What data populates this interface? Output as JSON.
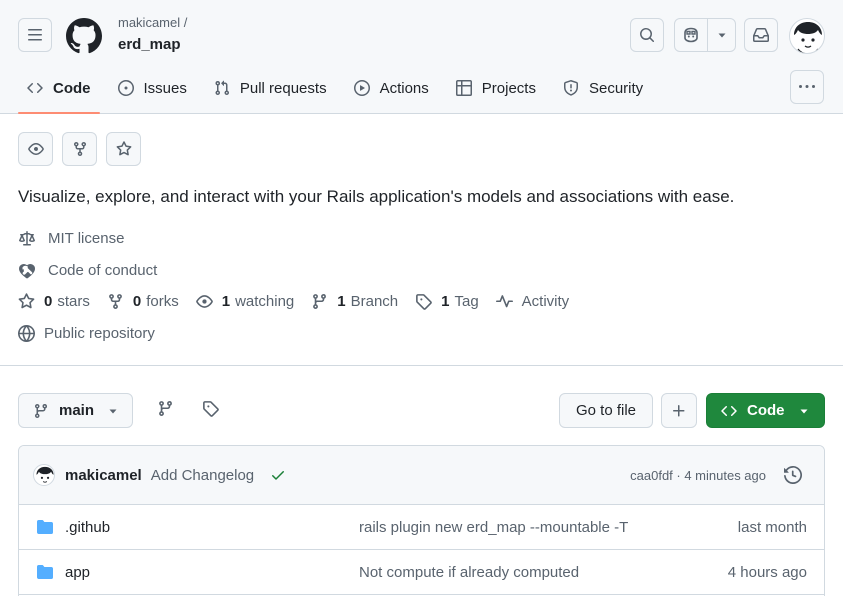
{
  "header": {
    "owner": "makicamel /",
    "repo": "erd_map"
  },
  "tabs": [
    {
      "label": "Code",
      "icon": "code-icon"
    },
    {
      "label": "Issues",
      "icon": "issue-icon"
    },
    {
      "label": "Pull requests",
      "icon": "pull-request-icon"
    },
    {
      "label": "Actions",
      "icon": "play-icon"
    },
    {
      "label": "Projects",
      "icon": "table-icon"
    },
    {
      "label": "Security",
      "icon": "shield-icon"
    }
  ],
  "about": {
    "description": "Visualize, explore, and interact with your Rails application's models and associations with ease.",
    "license": "MIT license",
    "conduct": "Code of conduct",
    "stars_count": "0",
    "stars_label": "stars",
    "forks_count": "0",
    "forks_label": "forks",
    "watching_count": "1",
    "watching_label": "watching",
    "branch_count": "1",
    "branch_label": "Branch",
    "tag_count": "1",
    "tag_label": "Tag",
    "activity": "Activity",
    "visibility": "Public repository"
  },
  "toolbar": {
    "branch": "main",
    "goto_file": "Go to file",
    "code_label": "Code"
  },
  "commit": {
    "author": "makicamel",
    "message": "Add Changelog",
    "sha_time": "caa0fdf · 4 minutes ago"
  },
  "files": [
    {
      "name": ".github",
      "message": "rails plugin new erd_map --mountable -T",
      "date": "last month"
    },
    {
      "name": "app",
      "message": "Not compute if already computed",
      "date": "4 hours ago"
    }
  ],
  "colors": {
    "accent_underline": "#fd8c73",
    "primary_button": "#1f883d",
    "folder": "#54aeff",
    "success": "#1a7f37"
  }
}
